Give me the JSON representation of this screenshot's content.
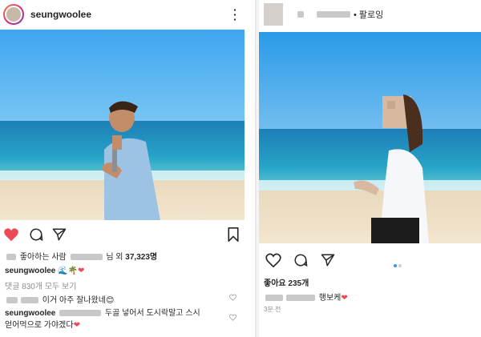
{
  "left_post": {
    "username": "seungwoolee",
    "likes_prefix": "좋아하는 사람",
    "likes_suffix": "님 외",
    "likes_count": "37,323명",
    "caption_user": "seungwoolee",
    "view_comments": "댓글 830개 모두 보기",
    "comment1_text": "이거 아주 잘나왔네",
    "comment2_user": "seungwoolee",
    "comment2_text_a": "두골 넣어서 도시락말고 스시",
    "comment2_text_b": "얻어먹으로 가야겠다"
  },
  "right_post": {
    "follow_label": "• 팔로잉",
    "likes": "좋아요 235개",
    "caption_text": "행보케",
    "timestamp": "3분 전"
  },
  "colors": {
    "heart_red": "#ed4956",
    "accent_blue": "#3897f0"
  }
}
